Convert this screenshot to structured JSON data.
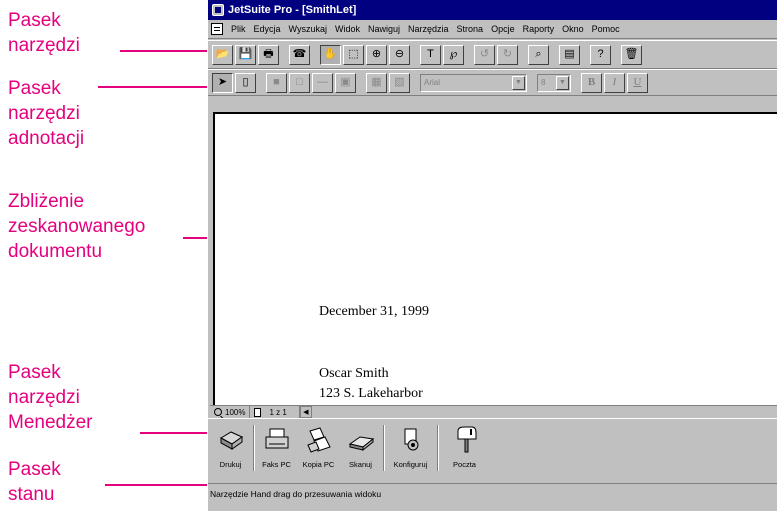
{
  "callouts": {
    "toolbar": "Pasek\nnarzędzi",
    "annotation_toolbar": "Pasek\nnarzędzi\nadnotacji",
    "document_zoom": "Zbliżenie\nzeskanowanego\ndokumentu",
    "manager_toolbar": "Pasek\nnarzędzi\nMenedżer",
    "status_bar": "Pasek\nstanu"
  },
  "window": {
    "title": "JetSuite Pro - [SmithLet]"
  },
  "menu": [
    "Plik",
    "Edycja",
    "Wyszukaj",
    "Widok",
    "Nawiguj",
    "Narzędzia",
    "Strona",
    "Opcje",
    "Raporty",
    "Okno",
    "Pomoc"
  ],
  "annotation_toolbar": {
    "font_name": "Arial",
    "font_size": "8",
    "bold_label": "B",
    "italic_label": "I",
    "underline_label": "U"
  },
  "document": {
    "date": "December 31, 1999",
    "recipient_name": "Oscar Smith",
    "recipient_street": "123 S. Lakeharbor"
  },
  "view_status": {
    "zoom": "100%",
    "page_counter": "1 z 1"
  },
  "manager_buttons": [
    "Drukuj",
    "Faks PC",
    "Kopia PC",
    "Skanuj",
    "Konfiguruj",
    "Poczta"
  ],
  "status_text": "Narzędzie Hand drag do przesuwania widoku",
  "colors": {
    "callout": "#e5007e",
    "title_bar": "#000080",
    "chrome": "#c0c0c0"
  }
}
